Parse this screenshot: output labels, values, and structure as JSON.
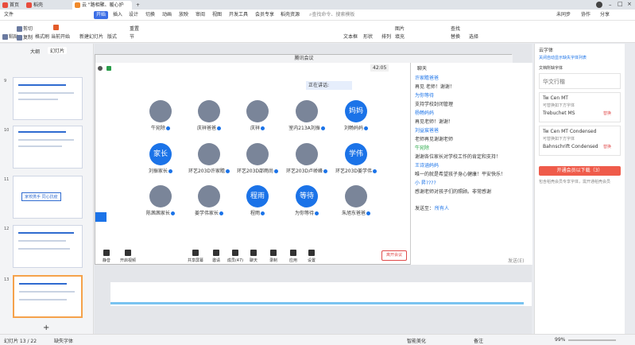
{
  "tabs": {
    "home": "首页",
    "wps": "稻壳",
    "doc": "云 \"路相聚、暖心护成...\"",
    "add": "+"
  },
  "ribbon": {
    "file": "文件",
    "tabs": [
      "开始",
      "插入",
      "设计",
      "切换",
      "动画",
      "放映",
      "审阅",
      "视图",
      "开发工具",
      "会员专享",
      "稻壳资源"
    ],
    "search": "查找命令、搜索模板",
    "unsync": "未同步",
    "collab": "协作",
    "share": "分享"
  },
  "toolbar": {
    "paste": "粘贴",
    "cut": "剪切",
    "copy": "复制",
    "format": "格式刷",
    "current_slide": "当前开始",
    "play": "从头开始",
    "new_slide": "新建幻灯片",
    "layout": "版式",
    "section": "节",
    "reset": "重置",
    "text_box": "文本框",
    "shape": "形状",
    "arrange": "排列",
    "image": "图片",
    "fill": "填充",
    "find": "查找",
    "replace": "替换",
    "select": "选择",
    "fit": "适应宽度"
  },
  "leftpanel": {
    "tab_outline": "大纲",
    "tab_slides": "幻灯片",
    "slides": [
      "9",
      "10",
      "11",
      "12",
      "13"
    ],
    "slide11_text": "家校携手 同心抗疫"
  },
  "meeting": {
    "window_title": "腾讯会议",
    "timer": "42:05",
    "speaking": "正在讲话:",
    "participants": [
      {
        "name": "牛宛除",
        "avatar": "photo"
      },
      {
        "name": "庆祥爸爸",
        "avatar": "photo"
      },
      {
        "name": "庆祥",
        "avatar": "photo"
      },
      {
        "name": "室内213A刘振",
        "avatar": "photo"
      },
      {
        "name": "刘畅妈妈",
        "avatar": "妈妈"
      },
      {
        "name": "刘振家长",
        "avatar": "家长"
      },
      {
        "name": "环艺203D许家瞻",
        "avatar": "photo"
      },
      {
        "name": "环艺203D邵雨尚",
        "avatar": "photo"
      },
      {
        "name": "环艺203D卢峤峰",
        "avatar": "photo"
      },
      {
        "name": "环艺203D姜学伟",
        "avatar": "学伟"
      },
      {
        "name": "陈茜茜家长",
        "avatar": "photo"
      },
      {
        "name": "姜学伟家长",
        "avatar": "photo"
      },
      {
        "name": "程雨",
        "avatar": "程雨"
      },
      {
        "name": "为你等待",
        "avatar": "等待"
      },
      {
        "name": "朱旭东爸爸",
        "avatar": "photo"
      }
    ],
    "buttons": [
      "静音",
      "开启视频",
      "共享屏幕",
      "邀请",
      "成员(47)",
      "聊天",
      "录制",
      "应用",
      "设置"
    ],
    "leave": "离开会议"
  },
  "chat": {
    "title": "聊天",
    "messages": [
      {
        "t": "许家瞻爸爸",
        "type": "name"
      },
      {
        "t": "再见 老师！谢谢！",
        "type": "text"
      },
      {
        "t": "为你等待",
        "type": "name"
      },
      {
        "t": "支持学校封闭管理",
        "type": "text"
      },
      {
        "t": "杨畅妈妈",
        "type": "name"
      },
      {
        "t": "再见老师！谢谢！",
        "type": "text"
      },
      {
        "t": "刘益宸爸爸",
        "type": "name"
      },
      {
        "t": "老师再见谢谢老师",
        "type": "text"
      },
      {
        "t": "牛宛除",
        "type": "nameg"
      },
      {
        "t": "谢谢各位家长对学校工作的肯定和支持！",
        "type": "text"
      },
      {
        "t": "王诗涵妈妈",
        "type": "name"
      },
      {
        "t": "唯一的就是希望孩子身心健康！平安快乐！",
        "type": "text"
      },
      {
        "t": "小 昇????",
        "type": "name"
      },
      {
        "t": "感谢老师对孩子们的照顾。非常感谢",
        "type": "text"
      }
    ],
    "send_to": "发送至：",
    "everyone": "所有人",
    "send": "发送(E)"
  },
  "rightpanel": {
    "title": "云字体",
    "subtitle": "关闭自动显示缺失字体列表",
    "missing": "文档所缺字体",
    "fonts": [
      {
        "name": "华文行楷",
        "note": ""
      },
      {
        "name": "Tw Cen MT",
        "note": "可替换如下方字体",
        "sub": "Trebuchet MS",
        "action": "替换"
      },
      {
        "name": "Tw Cen MT Condensed",
        "note": "可替换如下方字体",
        "sub": "Bahnschrift Condensed",
        "action": "替换"
      }
    ],
    "download": "开通会员以下载（3）",
    "member_note": "包含稻壳会员专享字体，需开通稻壳会员"
  },
  "status": {
    "slide": "幻灯片 13 / 22",
    "font": "缺失字体",
    "beautify": "智能美化",
    "notes": "备注",
    "zoom": "99%"
  }
}
